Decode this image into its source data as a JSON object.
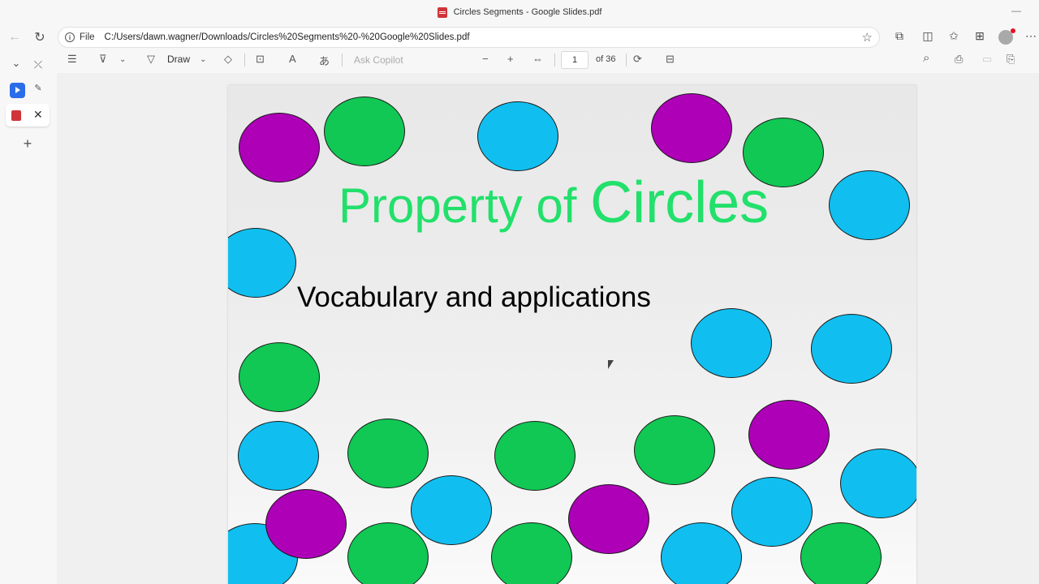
{
  "window": {
    "title": "Circles Segments - Google Slides.pdf",
    "minimize_glyph": "—"
  },
  "address": {
    "scheme_label": "File",
    "url": "C:/Users/dawn.wagner/Downloads/Circles%20Segments%20-%20Google%20Slides.pdf"
  },
  "icons": {
    "back": "←",
    "refresh": "↻",
    "star": "☆",
    "info": "i",
    "extensions": "⧉",
    "split": "◫",
    "favorites": "✩",
    "collections": "⊞",
    "more": "⋯",
    "rail_chevron": "⌄",
    "rail_pin": "⤫",
    "rail_pencil": "✎",
    "rail_close": "✕",
    "rail_add": "+",
    "contents": "☰",
    "highlight": "⊽",
    "draw": "▽",
    "erase": "◇",
    "textbox": "⊡",
    "read_aloud": "A",
    "translate": "あ",
    "zoom_out": "−",
    "zoom_in": "+",
    "fit": "⇔",
    "rotate": "⟳",
    "two_page": "⊟",
    "search": "⌕",
    "print": "⎙",
    "save": "▭",
    "save_as": "⎘"
  },
  "toolbar": {
    "draw_label": "Draw",
    "copilot_placeholder": "Ask Copilot",
    "page_current": "1",
    "page_total_label": "of 36"
  },
  "slide": {
    "title_part1": "Property of ",
    "title_part2": "Circles",
    "subtitle": "Vocabulary and applications",
    "colors": {
      "green": "#10c853",
      "blue": "#10bff0",
      "purple": "#ad00b7",
      "title": "#22e06b"
    }
  }
}
